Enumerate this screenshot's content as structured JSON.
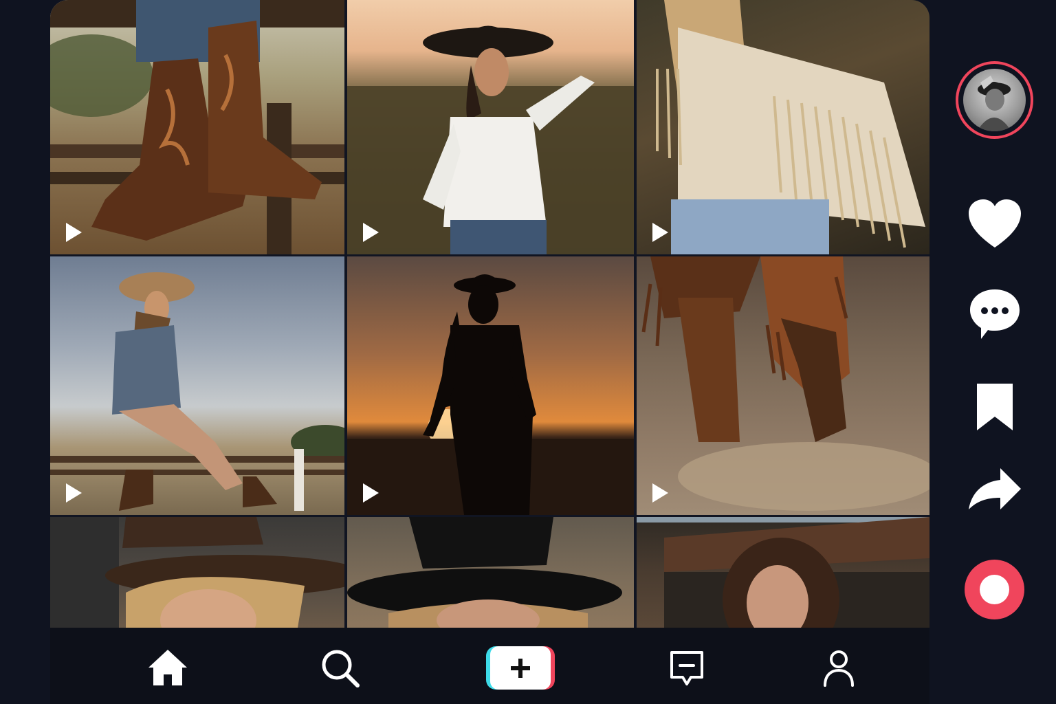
{
  "feed": {
    "tiles": [
      {
        "icon": "play-icon"
      },
      {
        "icon": "play-icon"
      },
      {
        "icon": "play-icon"
      },
      {
        "icon": "play-icon"
      },
      {
        "icon": "play-icon"
      },
      {
        "icon": "play-icon"
      },
      {},
      {},
      {}
    ]
  },
  "rail": {
    "avatar_ring_color": "#f0455c",
    "icons": [
      "heart-icon",
      "comment-icon",
      "bookmark-icon",
      "share-icon",
      "record-icon"
    ],
    "record_color": "#f0455c"
  },
  "bottom_nav": {
    "items": [
      "home-icon",
      "search-icon",
      "create-icon",
      "inbox-icon",
      "profile-icon"
    ],
    "create_colors": [
      "#3ddbe8",
      "#f0455c",
      "#ffffff"
    ]
  },
  "colors": {
    "background": "#0f1320",
    "icon": "#ffffff"
  }
}
